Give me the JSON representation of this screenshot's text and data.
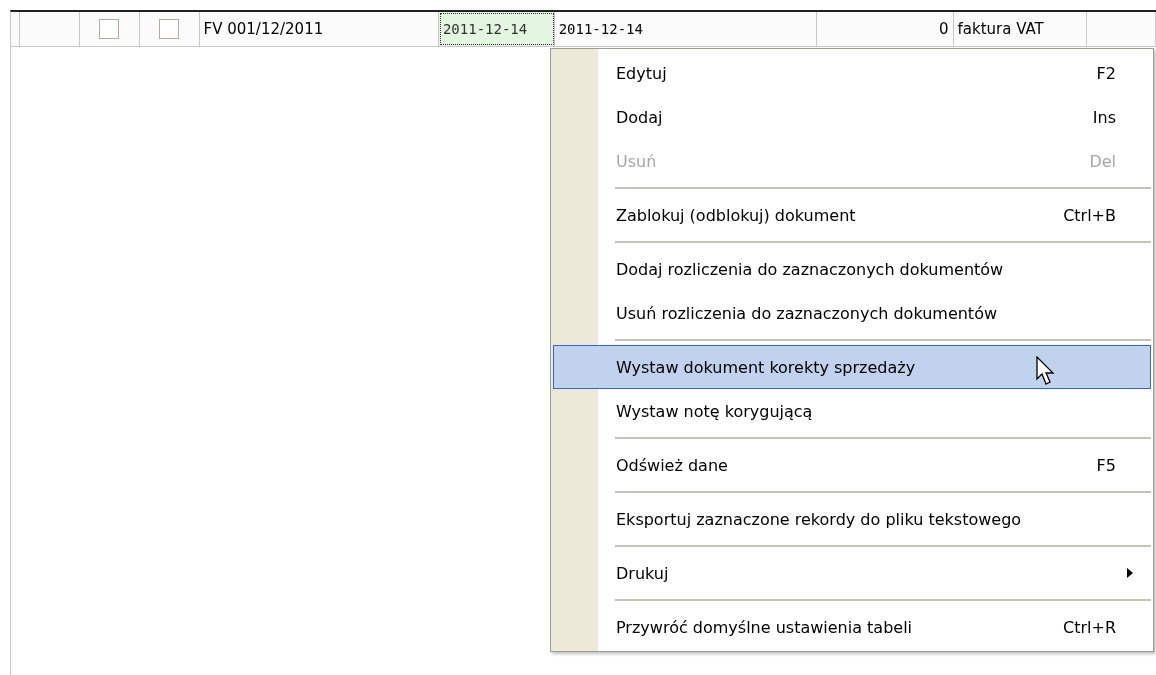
{
  "table": {
    "rows": [
      {
        "cells": [
          {
            "kind": "blank"
          },
          {
            "kind": "blank"
          },
          {
            "kind": "checkbox",
            "checked": false
          },
          {
            "kind": "checkbox",
            "checked": false
          },
          {
            "kind": "text",
            "text": "FV 001/12/2011"
          },
          {
            "kind": "date",
            "text": "2011-12-14",
            "selected": true
          },
          {
            "kind": "date",
            "text": "2011-12-14",
            "selected": false
          },
          {
            "kind": "number",
            "text": "0"
          },
          {
            "kind": "text",
            "text": "faktura VAT"
          },
          {
            "kind": "blank"
          }
        ]
      }
    ]
  },
  "context_menu": {
    "items": [
      {
        "kind": "item",
        "label": "Edytuj",
        "shortcut": "F2",
        "disabled": false,
        "selected": false
      },
      {
        "kind": "item",
        "label": "Dodaj",
        "shortcut": "Ins",
        "disabled": false,
        "selected": false
      },
      {
        "kind": "item",
        "label": "Usuń",
        "shortcut": "Del",
        "disabled": true,
        "selected": false
      },
      {
        "kind": "separator"
      },
      {
        "kind": "item",
        "label": "Zablokuj (odblokuj) dokument",
        "shortcut": "Ctrl+B",
        "disabled": false,
        "selected": false
      },
      {
        "kind": "separator"
      },
      {
        "kind": "item",
        "label": "Dodaj rozliczenia do zaznaczonych dokumentów",
        "disabled": false,
        "selected": false
      },
      {
        "kind": "item",
        "label": "Usuń rozliczenia do zaznaczonych dokumentów",
        "disabled": false,
        "selected": false
      },
      {
        "kind": "separator"
      },
      {
        "kind": "item",
        "label": "Wystaw dokument korekty sprzedaży",
        "disabled": false,
        "selected": true
      },
      {
        "kind": "item",
        "label": "Wystaw notę korygującą",
        "disabled": false,
        "selected": false
      },
      {
        "kind": "separator"
      },
      {
        "kind": "item",
        "label": "Odśwież dane",
        "shortcut": "F5",
        "disabled": false,
        "selected": false
      },
      {
        "kind": "separator"
      },
      {
        "kind": "item",
        "label": "Eksportuj zaznaczone rekordy do pliku tekstowego",
        "disabled": false,
        "selected": false
      },
      {
        "kind": "separator"
      },
      {
        "kind": "submenu",
        "label": "Drukuj",
        "disabled": false,
        "selected": false
      },
      {
        "kind": "separator"
      },
      {
        "kind": "item",
        "label": "Przywróć domyślne ustawienia tabeli",
        "shortcut": "Ctrl+R",
        "disabled": false,
        "selected": false
      }
    ]
  }
}
